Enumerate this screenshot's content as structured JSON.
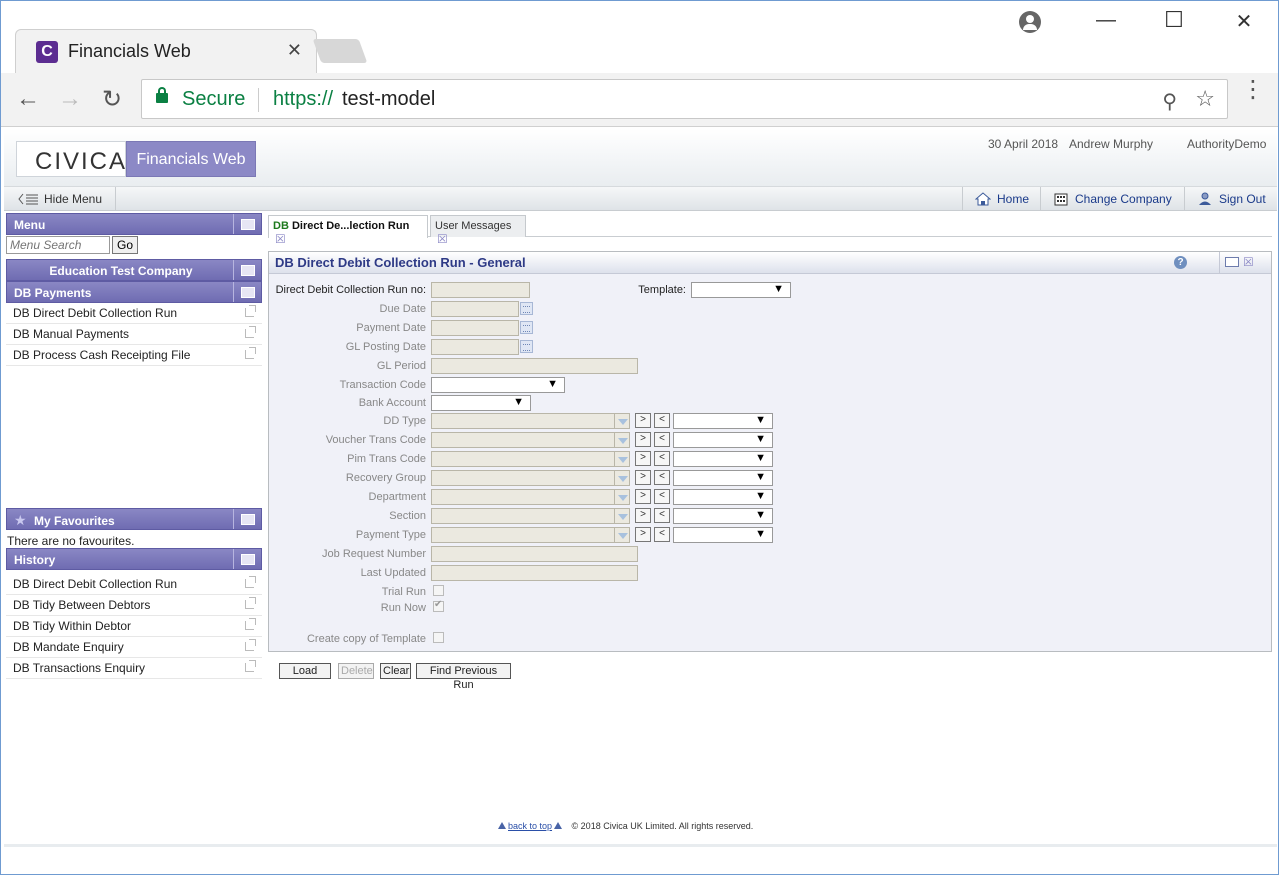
{
  "browser": {
    "tab_title": "Financials Web",
    "tab_favicon_letter": "C",
    "tab_close": "✕",
    "secure_label": "Secure",
    "url_scheme": "https://",
    "url_host": "test-model",
    "back_glyph": "←",
    "forward_glyph": "→",
    "reload_glyph": "↻",
    "zoom_glyph": "⚲",
    "star_glyph": "☆",
    "menu_glyph": "⋮",
    "minimize_glyph": "—",
    "maximize_glyph": "☐",
    "close_glyph": "✕"
  },
  "header": {
    "logo": "CIVICA",
    "app_title": "Financials Web",
    "date": "30 April 2018",
    "user": "Andrew Murphy",
    "authority": "AuthorityDemo"
  },
  "menubar": {
    "hide_menu": "Hide Menu",
    "home": "Home",
    "change_company": "Change Company",
    "sign_out": "Sign Out"
  },
  "sidebar": {
    "menu_title": "Menu",
    "search_placeholder": "Menu Search",
    "go_label": "Go",
    "company_name": "Education Test Company",
    "section_title": "DB Payments",
    "items": [
      {
        "label": "DB Direct Debit Collection Run"
      },
      {
        "label": "DB Manual Payments"
      },
      {
        "label": "DB Process Cash Receipting File"
      }
    ],
    "favourites_title": "My Favourites",
    "favourites_empty": "There are no favourites.",
    "history_title": "History",
    "history": [
      {
        "label": "DB Direct Debit Collection Run"
      },
      {
        "label": "DB Tidy Between Debtors"
      },
      {
        "label": "DB Tidy Within Debtor"
      },
      {
        "label": "DB Mandate Enquiry"
      },
      {
        "label": "DB Transactions Enquiry"
      }
    ]
  },
  "tabs": [
    {
      "prefix": "DB",
      "label": "Direct De...lection Run",
      "close": "☒"
    },
    {
      "prefix": "",
      "label": "User Messages",
      "close": "☒"
    }
  ],
  "panel": {
    "title": "DB Direct Debit Collection Run - General",
    "help_glyph": "?",
    "close_glyph": "☒"
  },
  "form": {
    "run_no_label": "Direct Debit Collection Run no:",
    "template_label": "Template:",
    "due_date_label": "Due Date",
    "payment_date_label": "Payment Date",
    "gl_posting_date_label": "GL Posting Date",
    "gl_period_label": "GL Period",
    "transaction_code_label": "Transaction Code",
    "bank_account_label": "Bank Account",
    "dd_type_label": "DD Type",
    "voucher_trans_code_label": "Voucher Trans Code",
    "pim_trans_code_label": "Pim Trans Code",
    "recovery_group_label": "Recovery Group",
    "department_label": "Department",
    "section_label": "Section",
    "payment_type_label": "Payment Type",
    "job_request_number_label": "Job Request Number",
    "last_updated_label": "Last Updated",
    "trial_run_label": "Trial Run",
    "run_now_label": "Run Now",
    "create_copy_label": "Create copy of Template",
    "trial_run_checked": false,
    "run_now_checked": true,
    "create_copy_checked": false,
    "move_right": ">",
    "move_left": "<"
  },
  "actions": {
    "load": "Load",
    "delete": "Delete",
    "clear": "Clear",
    "find_previous_run": "Find Previous Run"
  },
  "footer": {
    "back_to_top": "back to top",
    "copyright": "© 2018 Civica UK Limited. All rights reserved."
  }
}
